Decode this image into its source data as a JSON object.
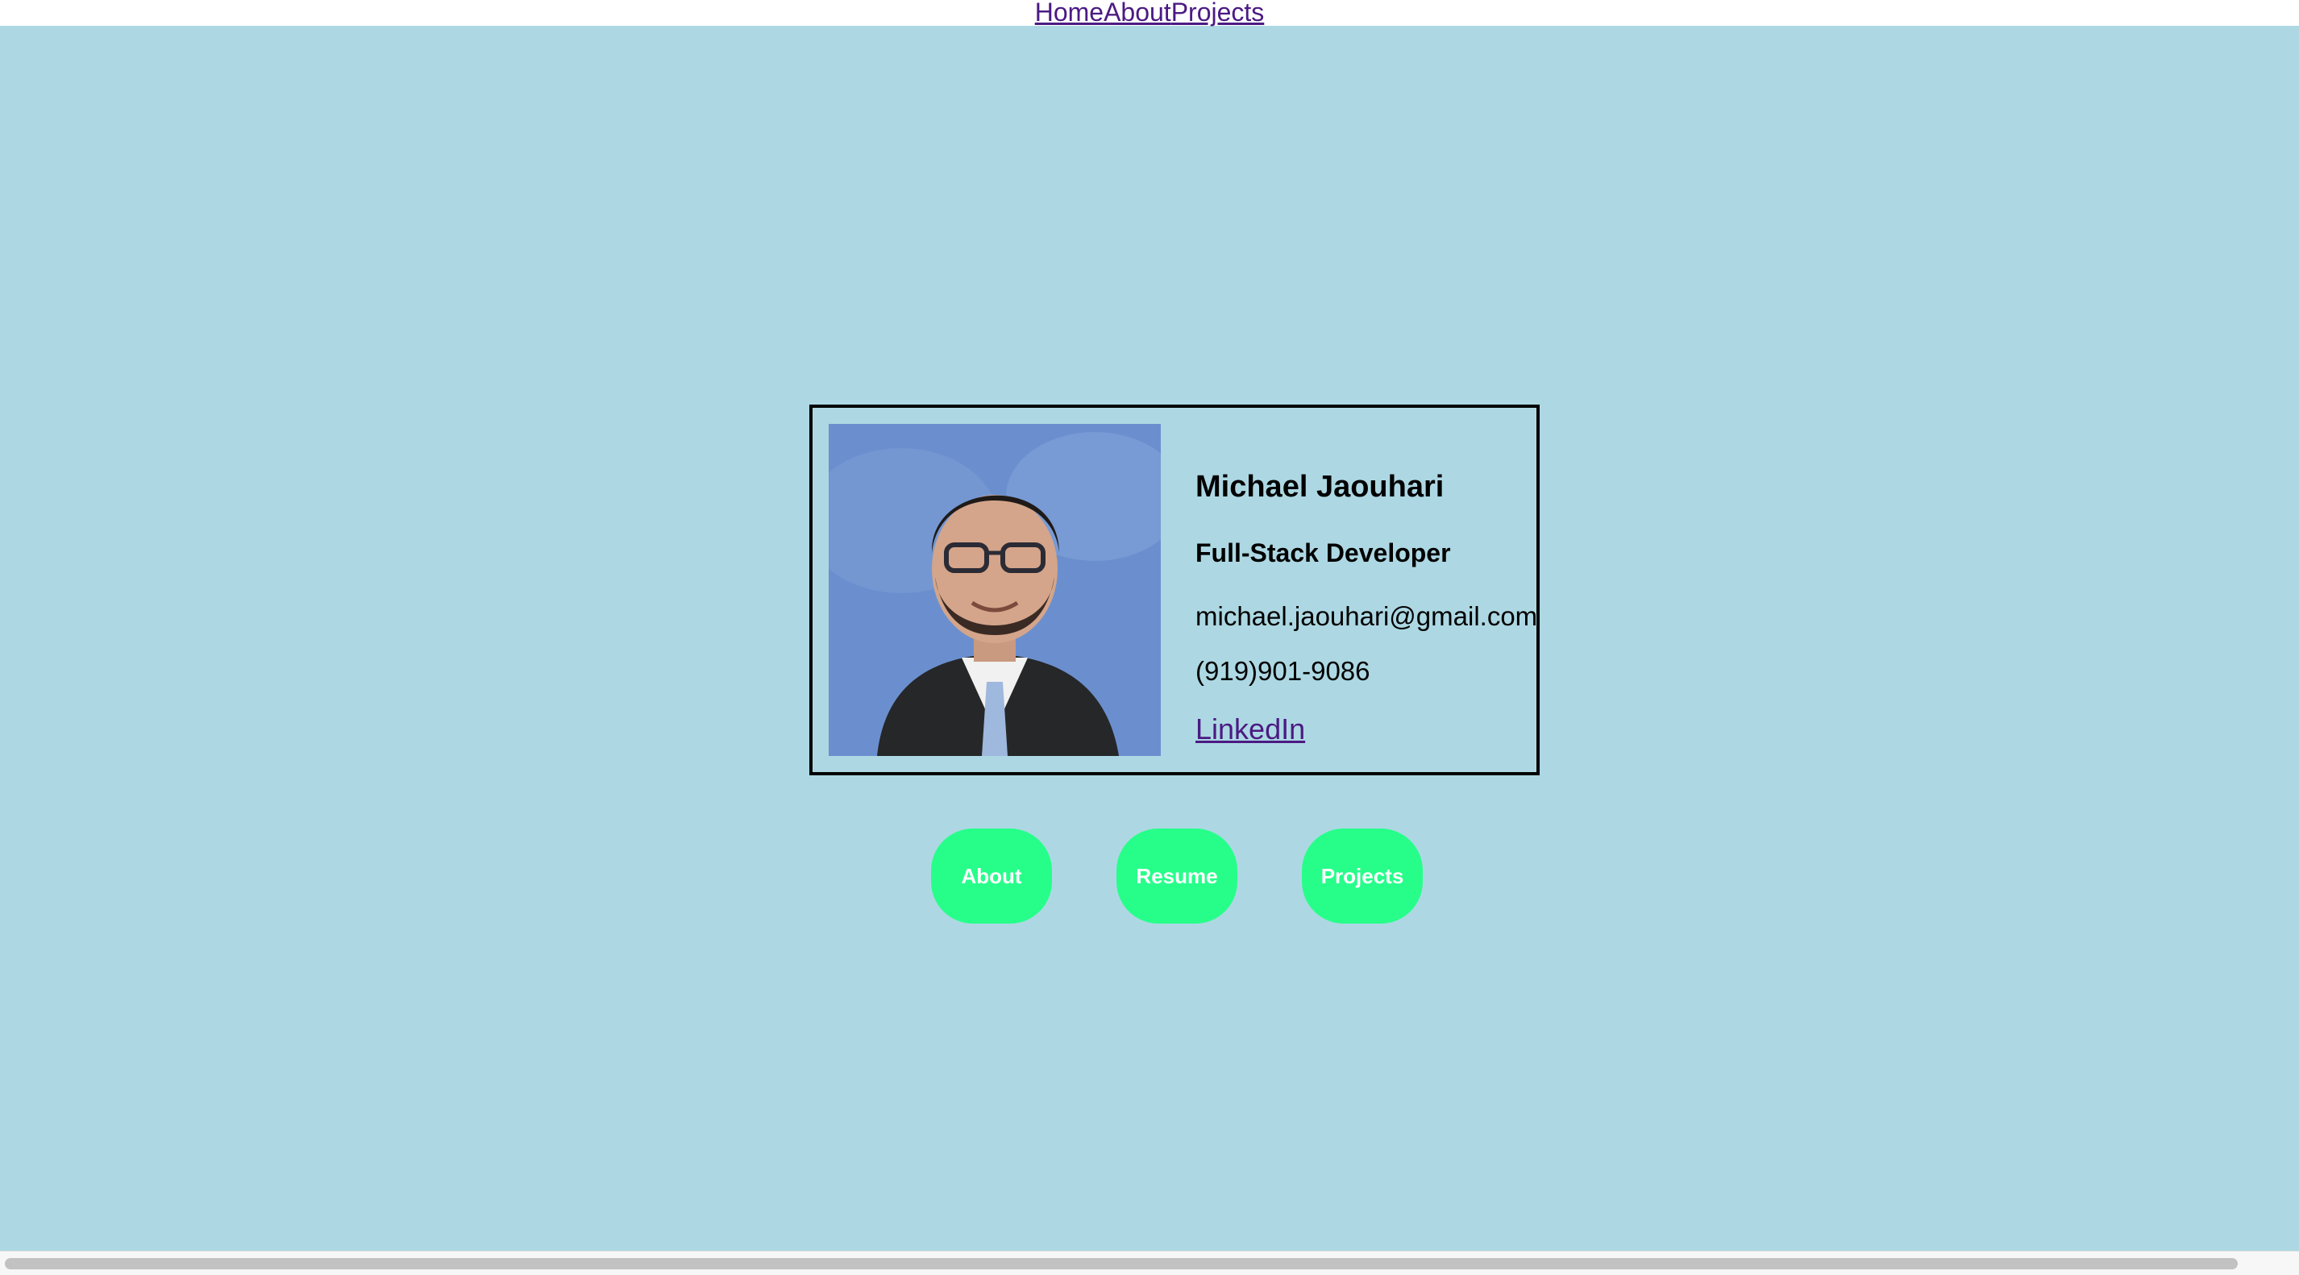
{
  "nav": {
    "links": [
      "Home",
      "About",
      "Projects"
    ]
  },
  "profile": {
    "name": "Michael Jaouhari",
    "title": "Full-Stack Developer",
    "email": "michael.jaouhari@gmail.com",
    "phone": "(919)901-9086",
    "linkedin_label": "LinkedIn",
    "photo_icon": "profile-photo"
  },
  "buttons": {
    "about": "About",
    "resume": "Resume",
    "projects": "Projects"
  },
  "colors": {
    "background": "#add8e3",
    "button": "#27fe8a",
    "link": "#4b1a83"
  }
}
